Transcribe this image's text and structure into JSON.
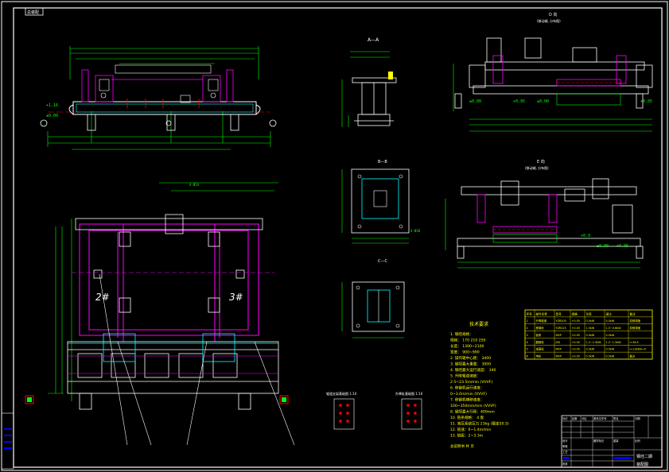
{
  "drawing": {
    "corner_label": "总装配",
    "views": {
      "top_elevation": "",
      "section_a": "A—A",
      "section_b": "B—B",
      "section_c": "C—C",
      "view_d": "D 向",
      "view_d_sub": "(移动端, 分布图)",
      "view_e": "E 向",
      "view_e_sub": "(移动端, 分布图)"
    },
    "station_marks": [
      "2#",
      "3#"
    ],
    "dimension_labels": [
      "+1.16",
      "±0.00",
      "±0.00",
      "+0.95",
      "±0.00",
      "+0.05",
      "+0.9",
      "±0.00",
      "+0.05",
      "4-Ø34",
      "4-Ø30"
    ]
  },
  "tech_requirements": {
    "title": "技术要求",
    "items": [
      "1. 钢坯规格：",
      "   规格： 170 210 250",
      "   长度： 1300~2100",
      "   宽度： 900~990",
      "2. 操作辊中心距： 3400",
      "3. 钢坯最大重量： 3000",
      "4. 钢坯最大运行速度： 340",
      "5. 升降辊道速度：",
      "   2.5~23.5m/min (VVVF)",
      "6. 移钢机运行速度：",
      "   0~3.0m/min (VVVF)",
      "7. 移钢机横移速度：",
      "   100~350mm/min (VVVF)",
      "8. 钢坯最大行程：400mm",
      "10. 链条规格： 4 套",
      "11. 液压系统压力 23kg (额定50.5)",
      "12. 链速：0~1.4m/min",
      "13. 链距：2~3.3m"
    ],
    "footer": "总说明书 共 页"
  },
  "param_table": {
    "headers": [
      "序号",
      "部件名称",
      "型号",
      "规格",
      "功率",
      "速比",
      "备注"
    ],
    "rows": [
      [
        "1",
        "升降辊道",
        "YZR200",
        "+0.05",
        "0.5kW",
        "0.5kW",
        "变频调速"
      ],
      [
        "2",
        "移钢机",
        "YZR225",
        "+0.05",
        "1.5kW",
        "1.5~0.6kW",
        "变频调速"
      ],
      [
        "3",
        "链条",
        "MXP",
        "+0.05",
        "0.5kW",
        "0.5kW",
        ""
      ],
      [
        "4",
        "翻钢机",
        "J56",
        "+0.05",
        "1.2~1.5kW",
        "1.2~1.5kW",
        "i=36.5"
      ],
      [
        "5",
        "减速机",
        "MXP",
        "+0.05",
        "0.5kW",
        "0.5kW",
        "i=12kW/i=0"
      ],
      [
        "6",
        "电机",
        "MXP",
        "+0.05",
        "0.5kW",
        "0.5kW",
        "备注"
      ]
    ]
  },
  "title_block": {
    "drawing_title": "钢坯二期",
    "drawing_no": "装配图",
    "labels": [
      "标记",
      "处数",
      "分区",
      "更改文件号",
      "签名",
      "日期",
      "设计",
      "审核",
      "工艺",
      "批准",
      "图样标记",
      "重量",
      "比例"
    ]
  },
  "detail_labels": {
    "left": "辊道支架基础图 1:10",
    "right": "升降缸基础图 1:10"
  },
  "colors": {
    "background": "#000000",
    "frame": "#ffffff",
    "structure": "#ff00ff",
    "outline": "#ffffff",
    "dimension": "#00ff00",
    "table": "#ffff00",
    "center_line": "#ff0000",
    "accent_cyan": "#00ffff"
  }
}
